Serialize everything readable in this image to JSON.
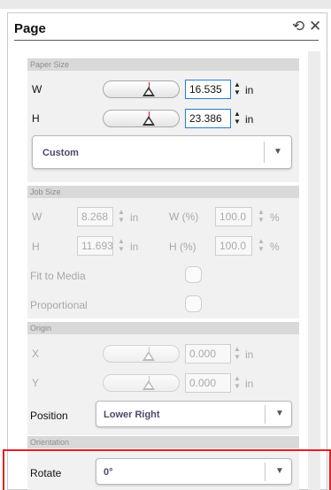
{
  "panel": {
    "title": "Page"
  },
  "icons": {
    "reset": "reset-circular-arrow-icon",
    "close": "close-x-icon"
  },
  "paper_size": {
    "header": "Paper Size",
    "w_label": "W",
    "w_value": "16.535",
    "w_unit": "in",
    "h_label": "H",
    "h_value": "23.386",
    "h_unit": "in",
    "preset_value": "Custom"
  },
  "job_size": {
    "header": "Job Size",
    "w_label": "W",
    "w_value": "8.268",
    "w_unit": "in",
    "wpct_label": "W (%)",
    "wpct_value": "100.0",
    "wpct_unit": "%",
    "h_label": "H",
    "h_value": "11.693",
    "h_unit": "in",
    "hpct_label": "H (%)",
    "hpct_value": "100.0",
    "hpct_unit": "%",
    "fit_label": "Fit to Media",
    "prop_label": "Proportional"
  },
  "origin": {
    "header": "Origin",
    "x_label": "X",
    "x_value": "0.000",
    "x_unit": "in",
    "y_label": "Y",
    "y_value": "0.000",
    "y_unit": "in",
    "position_label": "Position",
    "position_value": "Lower Right"
  },
  "orientation": {
    "header": "Orientation",
    "rotate_label": "Rotate",
    "rotate_value": "0°"
  },
  "colors": {
    "accent_border": "#2a7cc7",
    "highlight": "#e2202a"
  }
}
